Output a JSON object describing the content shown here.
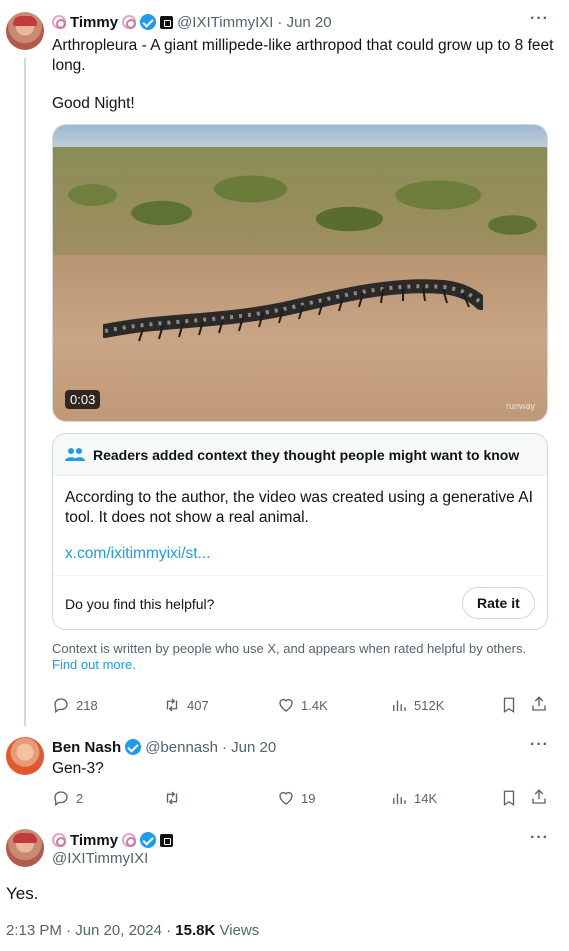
{
  "tweet1": {
    "name": "Timmy",
    "handle": "@IXITimmyIXI",
    "date": "· Jun 20",
    "text_line1": "Arthropleura - A giant millipede-like arthropod that could grow up to 8 feet",
    "text_line2": "long.",
    "text_line3": "Good Night!",
    "video_duration": "0:03",
    "video_watermark": "runway",
    "note": {
      "header": "Readers added context they thought people might want to know",
      "body_line1": "According to the author, the video was created using a generative AI",
      "body_line2": "tool. It does not show a real animal.",
      "link": "x.com/ixitimmyixi/st...",
      "question": "Do you find this helpful?",
      "rate_button": "Rate it"
    },
    "footer_line1": "Context is written by people who use X, and appears when rated helpful by others.",
    "footer_link": "Find out more.",
    "actions": {
      "replies": "218",
      "reposts": "407",
      "likes": "1.4K",
      "views": "512K"
    }
  },
  "tweet2": {
    "name": "Ben Nash",
    "handle": "@bennash",
    "date": "· Jun 20",
    "text": "Gen-3?",
    "actions": {
      "replies": "2",
      "reposts": "",
      "likes": "19",
      "views": "14K"
    }
  },
  "tweet3": {
    "name": "Timmy",
    "handle": "@IXITimmyIXI",
    "text": "Yes.",
    "time": "2:13 PM · Jun 20, 2024 · ",
    "views_count": "15.8K",
    "views_label": " Views"
  },
  "icons": {
    "more": "more-icon",
    "reply": "reply-icon",
    "repost": "repost-icon",
    "like": "like-icon",
    "views": "views-icon",
    "bookmark": "bookmark-icon",
    "share": "share-icon",
    "people": "people-icon"
  },
  "colors": {
    "accent": "#1d9bf0",
    "muted": "#536471",
    "text": "#0f1419"
  }
}
